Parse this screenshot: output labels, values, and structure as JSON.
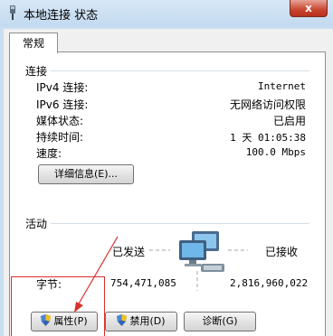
{
  "window": {
    "title": "本地连接 状态",
    "close_label": "x"
  },
  "tabs": [
    {
      "label": "常规"
    }
  ],
  "connection": {
    "heading": "连接",
    "rows": [
      {
        "label": "IPv4 连接:",
        "value": "Internet"
      },
      {
        "label": "IPv6 连接:",
        "value": "无网络访问权限"
      },
      {
        "label": "媒体状态:",
        "value": "已启用"
      },
      {
        "label": "持续时间:",
        "value": "1 天 01:05:38"
      },
      {
        "label": "速度:",
        "value": "100.0 Mbps"
      }
    ],
    "details_button": "详细信息(E)..."
  },
  "activity": {
    "heading": "活动",
    "sent_label": "已发送",
    "received_label": "已接收",
    "bytes_label": "字节:",
    "bytes_sent": "754,471,085",
    "bytes_received": "2,816,960,022"
  },
  "buttons": {
    "properties": "属性(P)",
    "disable": "禁用(D)",
    "diagnose": "诊断(G)"
  },
  "colors": {
    "annotation": "#d9302b",
    "titlebar": "#c9dff1",
    "close_button": "#c9452f"
  },
  "icons": [
    "network-adapter-icon",
    "network-computers-icon",
    "shield-icon"
  ]
}
